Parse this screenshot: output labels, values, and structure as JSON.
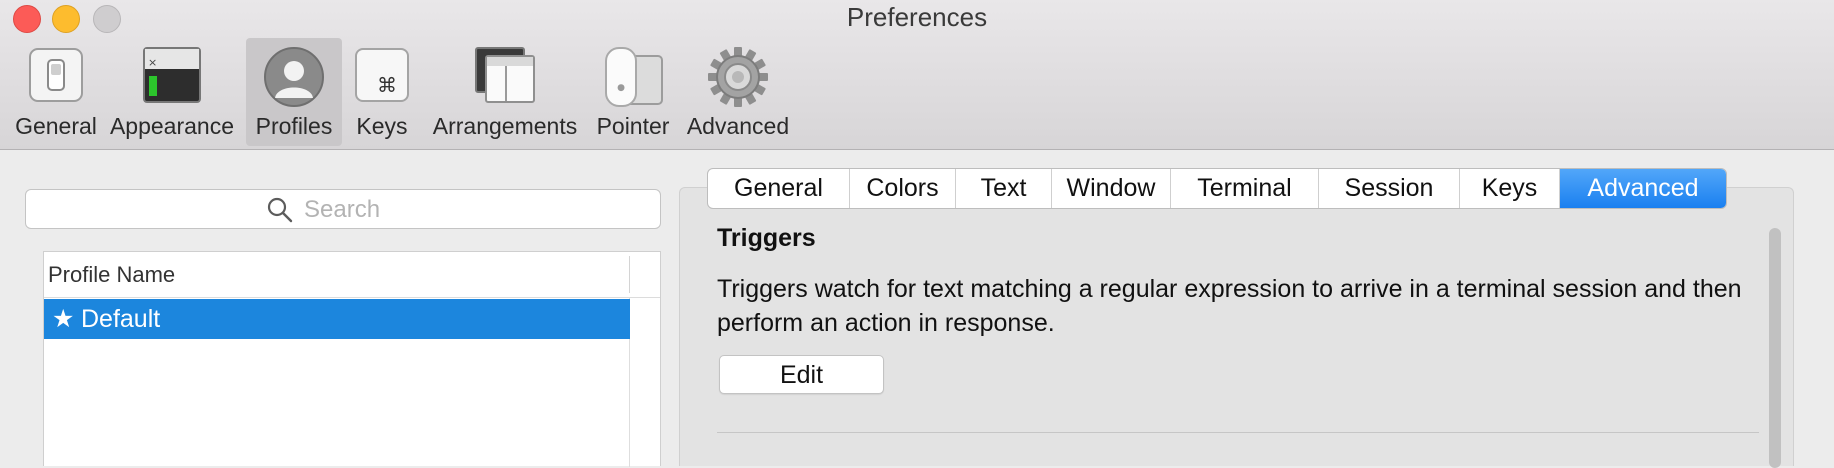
{
  "window": {
    "title": "Preferences"
  },
  "toolbar": {
    "items": [
      {
        "label": "General",
        "icon": "general-switch-icon"
      },
      {
        "label": "Appearance",
        "icon": "appearance-terminal-icon"
      },
      {
        "label": "Profiles",
        "icon": "profile-user-icon",
        "selected": true
      },
      {
        "label": "Keys",
        "icon": "command-key-icon"
      },
      {
        "label": "Arrangements",
        "icon": "window-arrangement-icon"
      },
      {
        "label": "Pointer",
        "icon": "mouse-icon"
      },
      {
        "label": "Advanced",
        "icon": "gear-icon"
      }
    ]
  },
  "left": {
    "search": {
      "placeholder": "Search"
    },
    "list": {
      "column_header": "Profile Name",
      "rows": [
        {
          "star": "★",
          "name": "Default",
          "selected": true
        }
      ]
    }
  },
  "right": {
    "tabs": [
      {
        "label": "General"
      },
      {
        "label": "Colors"
      },
      {
        "label": "Text"
      },
      {
        "label": "Window"
      },
      {
        "label": "Terminal"
      },
      {
        "label": "Session"
      },
      {
        "label": "Keys"
      },
      {
        "label": "Advanced",
        "active": true
      }
    ],
    "section_title": "Triggers",
    "description": "Triggers watch for text matching a regular expression to arrive in a terminal session and then perform an action in response.",
    "edit_button": "Edit"
  },
  "colors": {
    "accent": "#1c86dd",
    "tab_active": "#1a80f0",
    "close": "#fc5b57",
    "minimize": "#fdbc2e",
    "zoom_disabled": "#cfcdcf"
  }
}
